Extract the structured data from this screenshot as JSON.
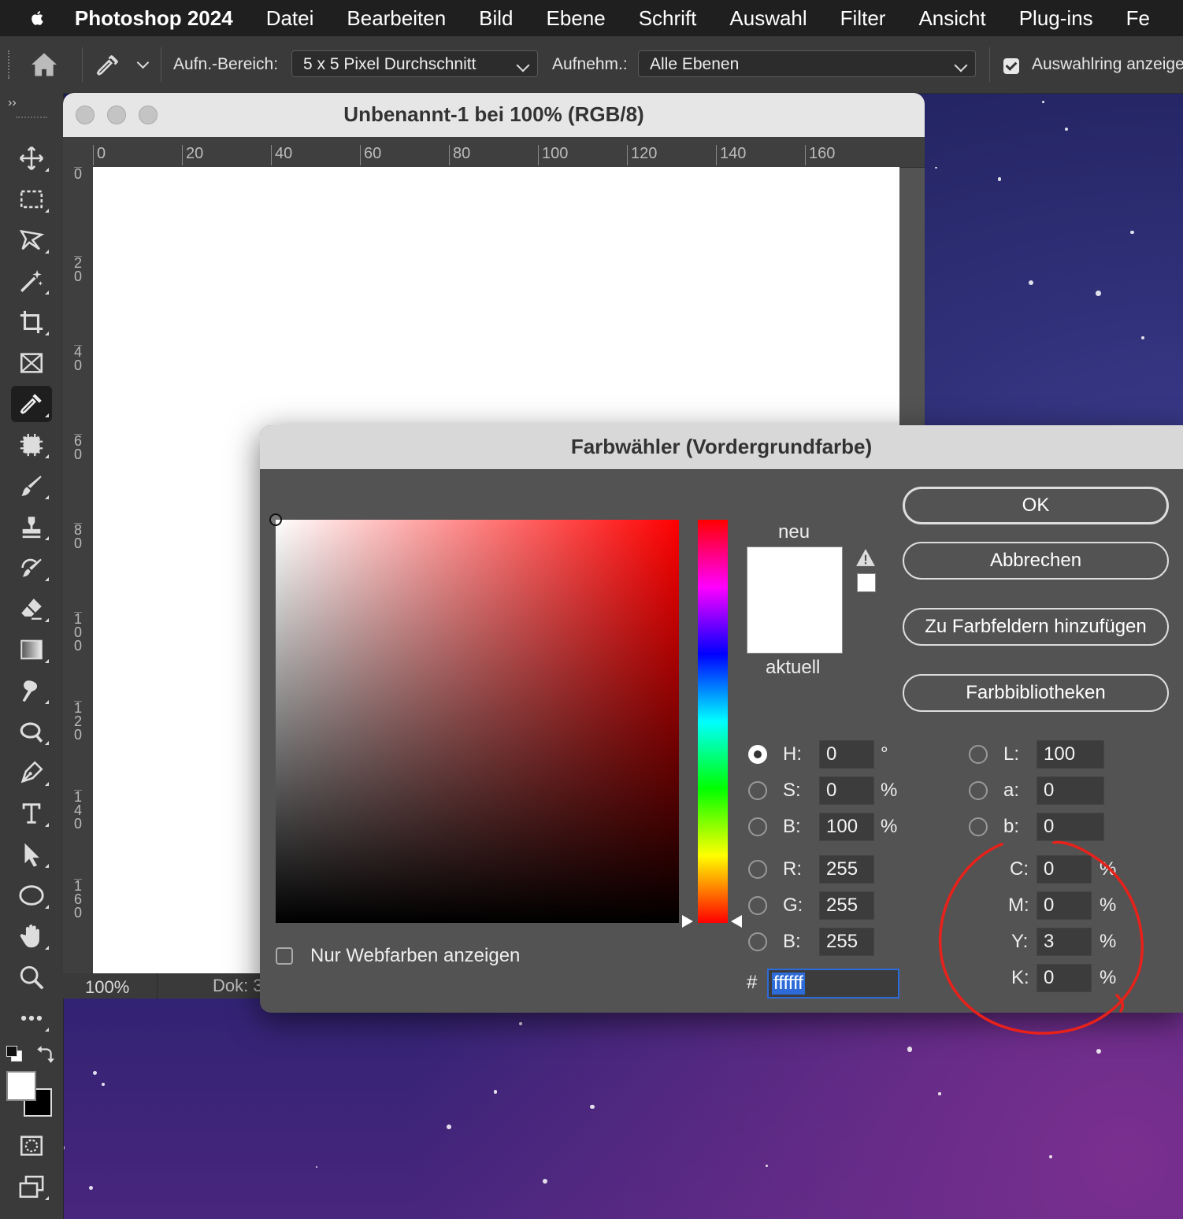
{
  "menubar": {
    "app": "Photoshop 2024",
    "items": [
      "Datei",
      "Bearbeiten",
      "Bild",
      "Ebene",
      "Schrift",
      "Auswahl",
      "Filter",
      "Ansicht",
      "Plug-ins",
      "Fe"
    ]
  },
  "options": {
    "sample_label": "Aufn.-Bereich:",
    "sample_value": "5 x 5 Pixel Durchschnitt",
    "layers_label": "Aufnehm.:",
    "layers_value": "Alle Ebenen",
    "ring_label": "Auswahlring anzeige",
    "ring_checked": true
  },
  "document": {
    "title": "Unbenannt-1 bei 100% (RGB/8)",
    "hruler": [
      "0",
      "20",
      "40",
      "60",
      "80",
      "100",
      "120",
      "140",
      "160"
    ],
    "vruler": [
      "0",
      "20",
      "40",
      "60",
      "80",
      "100",
      "120",
      "140",
      "160"
    ],
    "zoom": "100%",
    "dok": "Dok: 3"
  },
  "picker": {
    "title": "Farbwähler (Vordergrundfarbe)",
    "new_label": "neu",
    "current_label": "aktuell",
    "new_color": "#ffffff",
    "current_color": "#ffffff",
    "web_only_label": "Nur Webfarben anzeigen",
    "buttons": {
      "ok": "OK",
      "cancel": "Abbrechen",
      "add_swatch": "Zu Farbfeldern hinzufügen",
      "libraries": "Farbbibliotheken"
    },
    "hsb": {
      "h_label": "H:",
      "h": "0",
      "h_unit": "°",
      "s_label": "S:",
      "s": "0",
      "s_unit": "%",
      "b_label": "B:",
      "b": "100",
      "b_unit": "%"
    },
    "rgb": {
      "r_label": "R:",
      "r": "255",
      "g_label": "G:",
      "g": "255",
      "b_label": "B:",
      "b": "255"
    },
    "lab": {
      "l_label": "L:",
      "l": "100",
      "a_label": "a:",
      "a": "0",
      "b_label": "b:",
      "b": "0"
    },
    "cmyk": {
      "c_label": "C:",
      "c": "0",
      "m_label": "M:",
      "m": "0",
      "y_label": "Y:",
      "y": "3",
      "k_label": "K:",
      "k": "0",
      "unit": "%"
    },
    "hex_label": "#",
    "hex": "ffffff",
    "selected_mode": "H"
  },
  "annotation_color": "#e8211a"
}
